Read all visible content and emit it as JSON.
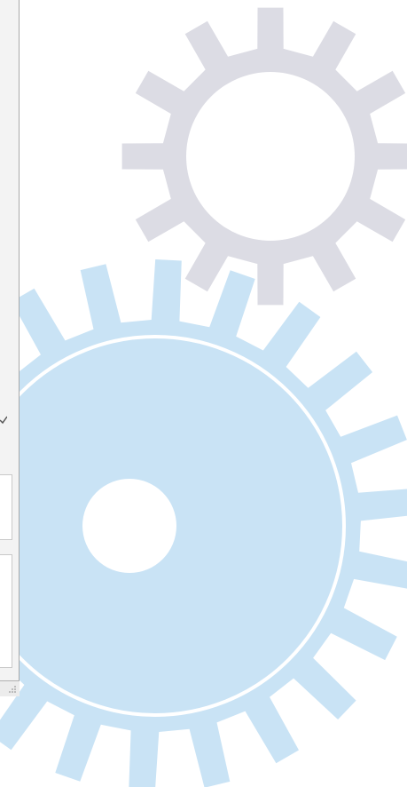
{
  "wallpaper": {
    "background_color": "#ffffff",
    "gear_top_color": "#dcdce4",
    "gear_bottom_color": "#c9e3f5",
    "gear_bottom_ring_color": "#ffffff"
  },
  "window": {
    "frame_color": "#f3f3f3",
    "field_color": "#ffffff",
    "icons": [
      "chevron-down-icon",
      "resize-grip-icon"
    ]
  }
}
